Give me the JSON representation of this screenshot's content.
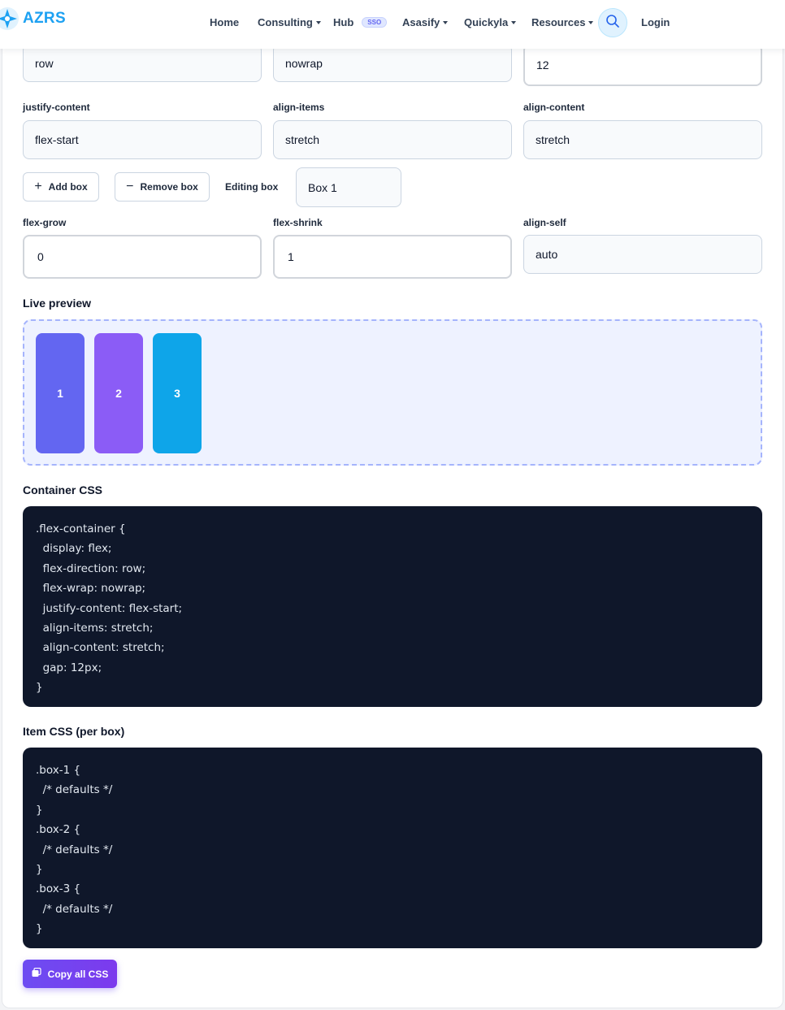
{
  "nav": {
    "logo_text": "AZRS",
    "items": [
      {
        "label": "Home"
      },
      {
        "label": "Consulting"
      },
      {
        "label": "Hub",
        "badge": "SSO"
      },
      {
        "label": "Asasify"
      },
      {
        "label": "Quickyla"
      },
      {
        "label": "Resources"
      }
    ],
    "login": "Login"
  },
  "container": {
    "flex_direction": "row",
    "flex_wrap": "nowrap",
    "gap": "12",
    "justify_content_label": "justify-content",
    "justify_content": "flex-start",
    "align_items_label": "align-items",
    "align_items": "stretch",
    "align_content_label": "align-content",
    "align_content": "stretch"
  },
  "boxes_controls": {
    "add_label": "Add box",
    "remove_label": "Remove box",
    "editing_label": "Editing box",
    "editing_value": "Box 1"
  },
  "item": {
    "flex_grow_label": "flex-grow",
    "flex_grow": "0",
    "flex_shrink_label": "flex-shrink",
    "flex_shrink": "1",
    "align_self_label": "align-self",
    "align_self": "auto"
  },
  "preview": {
    "title": "Live preview",
    "boxes": [
      {
        "label": "1",
        "color": "#6366f1"
      },
      {
        "label": "2",
        "color": "#8b5cf6"
      },
      {
        "label": "3",
        "color": "#0ea5e9"
      }
    ]
  },
  "container_css": {
    "title": "Container CSS",
    "lines": [
      ".flex-container {",
      "  display: flex;",
      "  flex-direction: row;",
      "  flex-wrap: nowrap;",
      "  justify-content: flex-start;",
      "  align-items: stretch;",
      "  align-content: stretch;",
      "  gap: 12px;",
      "}"
    ]
  },
  "item_css": {
    "title": "Item CSS (per box)",
    "lines": [
      ".box-1 {",
      "  /* defaults */",
      "}",
      ".box-2 {",
      "  /* defaults */",
      "}",
      ".box-3 {",
      "  /* defaults */",
      "}"
    ]
  },
  "copy_button": "Copy all CSS",
  "colors": {
    "accent": "#6d4df2",
    "brand": "#1da1f2",
    "code_bg": "#0f172a"
  }
}
